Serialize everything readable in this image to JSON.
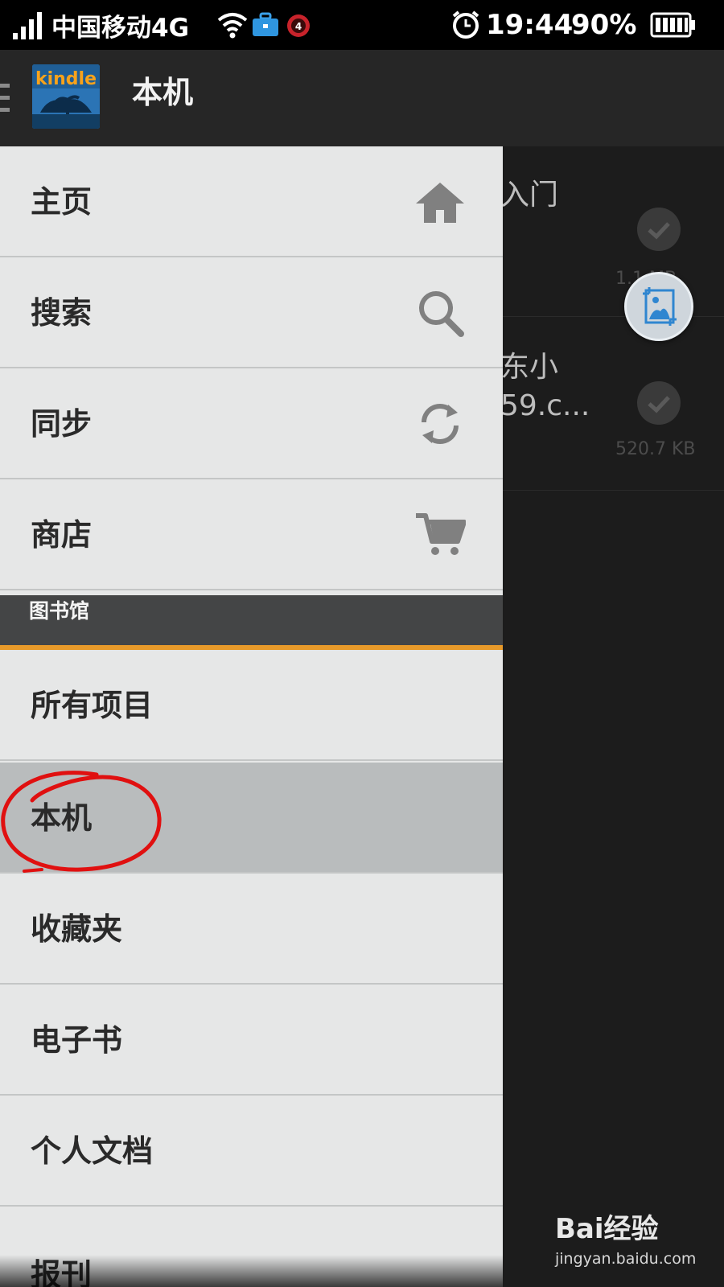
{
  "status_bar": {
    "carrier": "中国移动4G",
    "notification_badge": "4",
    "time": "19:44",
    "battery": "90%"
  },
  "action_bar": {
    "logo_text": "kindle",
    "title": "本机"
  },
  "content": {
    "items": [
      {
        "title": "入门",
        "size": "1.1 MB"
      },
      {
        "title_line1": "东小",
        "title_line2": "59.c...",
        "size": "520.7 KB"
      }
    ]
  },
  "drawer": {
    "top_items": [
      {
        "label": "主页",
        "icon": "home-icon"
      },
      {
        "label": "搜索",
        "icon": "search-icon"
      },
      {
        "label": "同步",
        "icon": "sync-icon"
      },
      {
        "label": "商店",
        "icon": "cart-icon"
      }
    ],
    "section_label": "图书馆",
    "library_items": [
      {
        "label": "所有项目"
      },
      {
        "label": "本机",
        "selected": true
      },
      {
        "label": "收藏夹"
      },
      {
        "label": "电子书"
      },
      {
        "label": "个人文档"
      },
      {
        "label": "报刊"
      }
    ]
  },
  "watermark": {
    "brand": "Bai经验",
    "url": "jingyan.baidu.com"
  },
  "colors": {
    "drawer_bg": "#e6e7e7",
    "selected_bg": "#b9bcbd",
    "section_accent": "#e89a2a",
    "annotation_red": "#e01010"
  }
}
